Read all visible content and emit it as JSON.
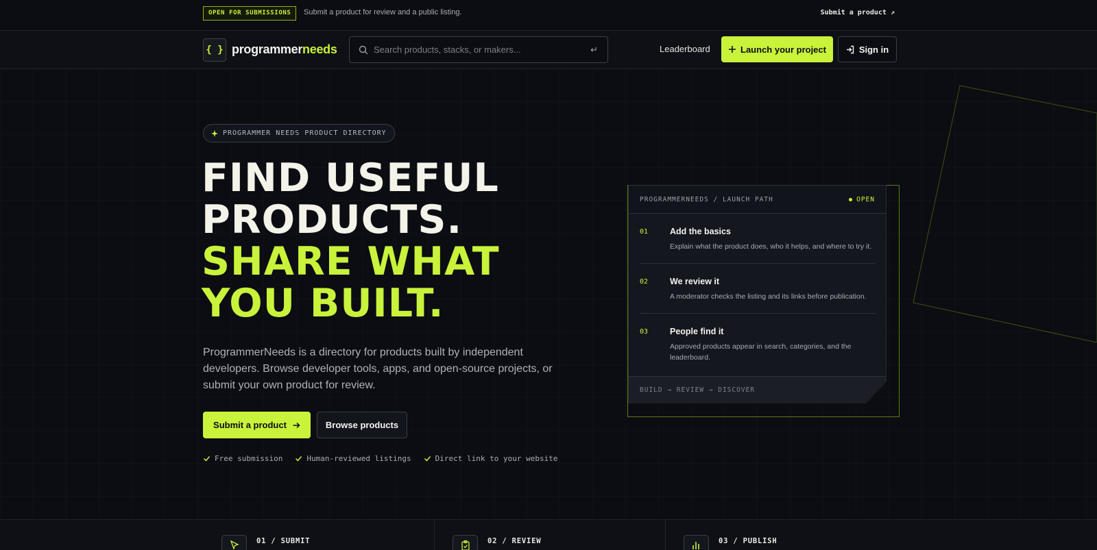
{
  "announcement": {
    "badge": "OPEN FOR SUBMISSIONS",
    "message": "Submit a product for review and a public listing.",
    "link": "Submit a product ↗"
  },
  "header": {
    "logo_glyph": "{ }",
    "logo_part1": "programmer",
    "logo_part2": "needs",
    "search_placeholder": "Search products, stacks, or makers...",
    "search_enter_glyph": "↵",
    "nav_leaderboard": "Leaderboard",
    "launch_button": "Launch your project",
    "signin_button": "Sign in"
  },
  "hero": {
    "pill": "PROGRAMMER NEEDS PRODUCT DIRECTORY",
    "headline_lines": [
      "FIND USEFUL",
      "PRODUCTS.",
      "SHARE WHAT",
      "YOU BUILT."
    ],
    "lede": "ProgrammerNeeds is a directory for products built by independent developers. Browse developer tools, apps, and open-source projects, or submit your own product for review.",
    "primary_cta": "Submit a product",
    "secondary_cta": "Browse products",
    "checks": [
      "Free submission",
      "Human-reviewed listings",
      "Direct link to your website"
    ]
  },
  "launch_card": {
    "title": "PROGRAMMERNEEDS / LAUNCH PATH",
    "status": "OPEN",
    "steps": [
      {
        "num": "01",
        "title": "Add the basics",
        "desc": "Explain what the product does, who it helps, and where to try it."
      },
      {
        "num": "02",
        "title": "We review it",
        "desc": "A moderator checks the listing and its links before publication."
      },
      {
        "num": "03",
        "title": "People find it",
        "desc": "Approved products appear in search, categories, and the leaderboard."
      }
    ],
    "footer": "BUILD → REVIEW → DISCOVER"
  },
  "strip": {
    "items": [
      {
        "label": "01 / SUBMIT",
        "icon": "cursor-icon"
      },
      {
        "label": "02 / REVIEW",
        "icon": "clipboard-check-icon"
      },
      {
        "label": "03 / PUBLISH",
        "icon": "bar-chart-icon"
      }
    ]
  },
  "colors": {
    "accent": "#c9f23b",
    "background": "#0b0d12",
    "border": "#3a3f47"
  }
}
